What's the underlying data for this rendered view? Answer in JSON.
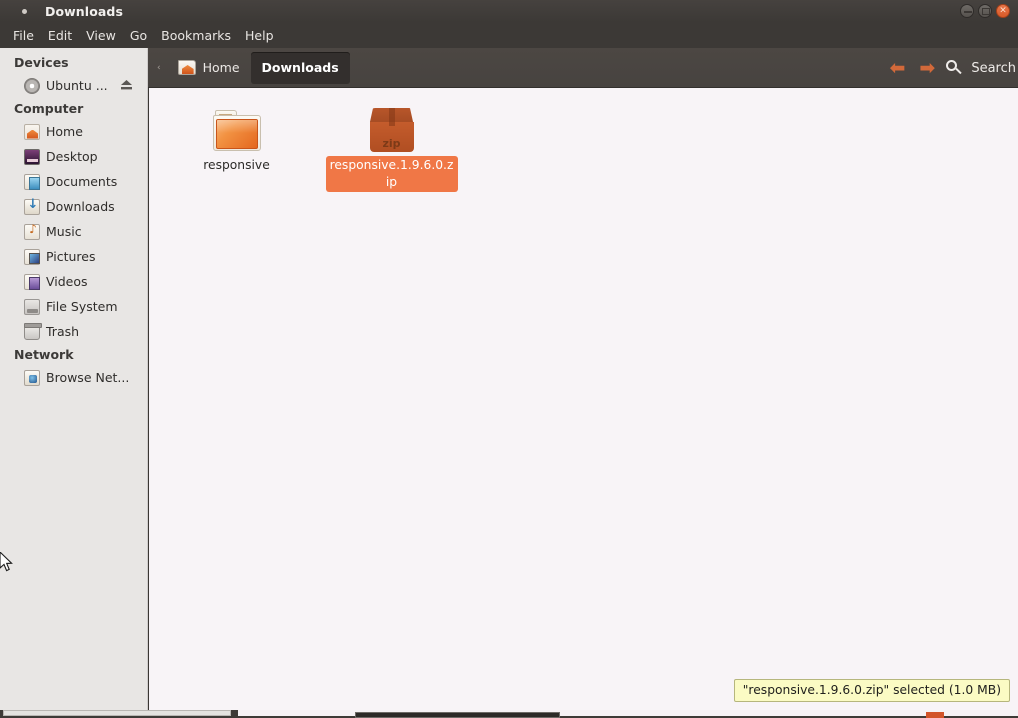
{
  "window": {
    "title": "Downloads",
    "controls": [
      {
        "name": "minimize",
        "glyph": "–"
      },
      {
        "name": "maximize",
        "glyph": "□"
      },
      {
        "name": "close",
        "glyph": "×"
      }
    ]
  },
  "menubar": {
    "items": [
      {
        "label": "File"
      },
      {
        "label": "Edit"
      },
      {
        "label": "View"
      },
      {
        "label": "Go"
      },
      {
        "label": "Bookmarks"
      },
      {
        "label": "Help"
      }
    ]
  },
  "sidebar": {
    "groups": [
      {
        "title": "Devices",
        "items": [
          {
            "label": "Ubuntu ...",
            "icon": "optical-disc-icon",
            "icon_class": "ic-disc",
            "eject": true
          }
        ]
      },
      {
        "title": "Computer",
        "items": [
          {
            "label": "Home",
            "icon": "home-folder-icon",
            "icon_class": "ic-home",
            "eject": false
          },
          {
            "label": "Desktop",
            "icon": "desktop-icon",
            "icon_class": "ic-desktop",
            "eject": false
          },
          {
            "label": "Documents",
            "icon": "documents-folder-icon",
            "icon_class": "ic-docs",
            "eject": false
          },
          {
            "label": "Downloads",
            "icon": "downloads-folder-icon",
            "icon_class": "ic-dl",
            "eject": false
          },
          {
            "label": "Music",
            "icon": "music-folder-icon",
            "icon_class": "ic-music",
            "eject": false
          },
          {
            "label": "Pictures",
            "icon": "pictures-folder-icon",
            "icon_class": "ic-pics",
            "eject": false
          },
          {
            "label": "Videos",
            "icon": "videos-folder-icon",
            "icon_class": "ic-vids",
            "eject": false
          },
          {
            "label": "File System",
            "icon": "filesystem-icon",
            "icon_class": "ic-fs",
            "eject": false
          },
          {
            "label": "Trash",
            "icon": "trash-icon",
            "icon_class": "ic-trash",
            "eject": false
          }
        ]
      },
      {
        "title": "Network",
        "items": [
          {
            "label": "Browse Net...",
            "icon": "network-browse-icon",
            "icon_class": "ic-net",
            "eject": false
          }
        ]
      }
    ]
  },
  "toolbar": {
    "chevron": "‹",
    "path_buttons": [
      {
        "label": "Home",
        "active": false,
        "icon": "home-folder-icon"
      },
      {
        "label": "Downloads",
        "active": true,
        "icon": null
      }
    ],
    "back_arrow": "⬅",
    "forward_arrow": "➡",
    "search_label": "Search",
    "search_icon": "search-icon"
  },
  "files": [
    {
      "name": "responsive",
      "kind": "folder",
      "icon": "folder-icon",
      "selected": false
    },
    {
      "name": "responsive.1.9.6.0.zip",
      "kind": "archive",
      "icon": "zip-archive-icon",
      "icon_label": "zip",
      "selected": true
    }
  ],
  "statusbar": {
    "text": "\"responsive.1.9.6.0.zip\" selected (1.0 MB)"
  },
  "colors": {
    "titlebar": "#3c3936",
    "toolbar": "#4a4542",
    "sidebar": "#e8e6e4",
    "fileview": "#f8f4f7",
    "selection": "#f07746",
    "accent_arrow": "#d2693a",
    "status_bg": "#fbfbc4",
    "close_button": "#e06a34"
  }
}
